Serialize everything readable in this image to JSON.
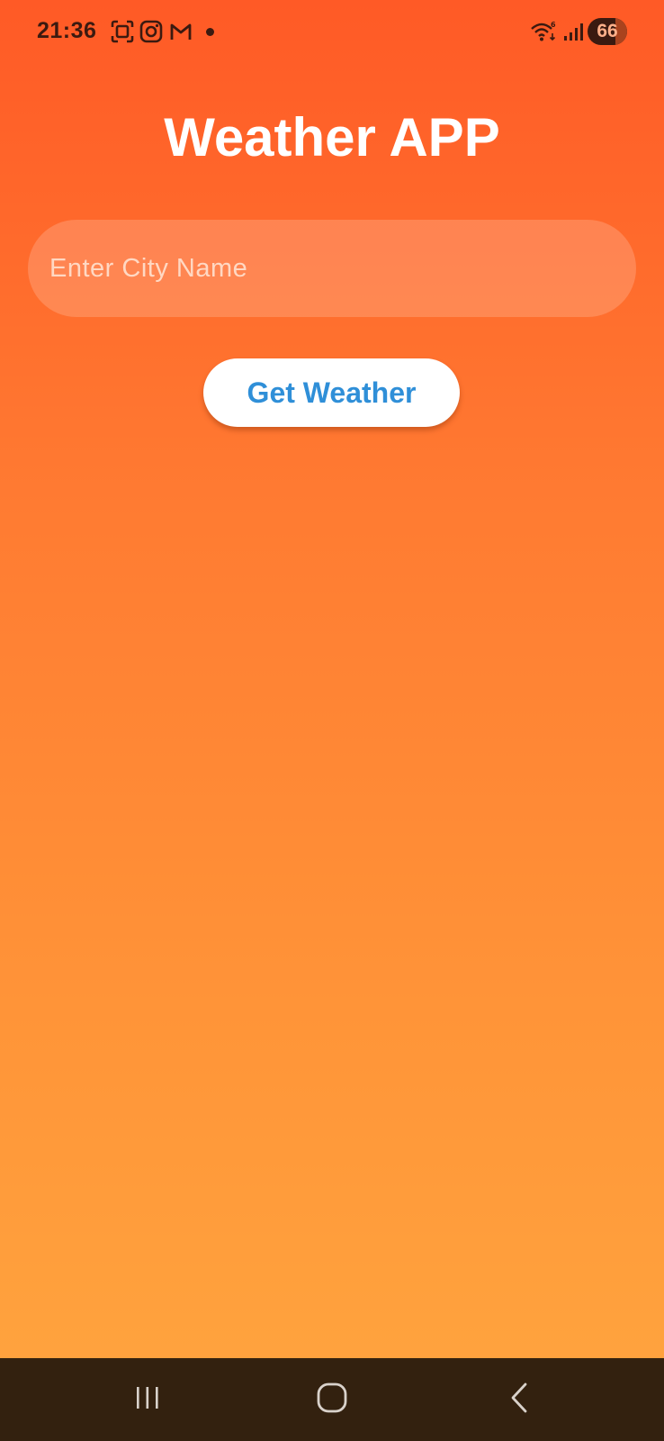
{
  "status_bar": {
    "time": "21:36",
    "battery": "66",
    "icons": [
      "screenshot-icon",
      "instagram-icon",
      "gmail-icon",
      "notification-dot",
      "wifi-icon",
      "signal-icon",
      "battery-icon"
    ]
  },
  "app": {
    "title": "Weather APP"
  },
  "search": {
    "placeholder": "Enter City Name",
    "value": ""
  },
  "actions": {
    "get_weather_label": "Get Weather"
  },
  "navigation": {
    "items": [
      "recent-apps",
      "home",
      "back"
    ]
  },
  "colors": {
    "gradient_top": "#ff5a26",
    "gradient_bottom": "#ffa63f",
    "button_text": "#2f8fd8",
    "nav_bar": "#33210f"
  }
}
